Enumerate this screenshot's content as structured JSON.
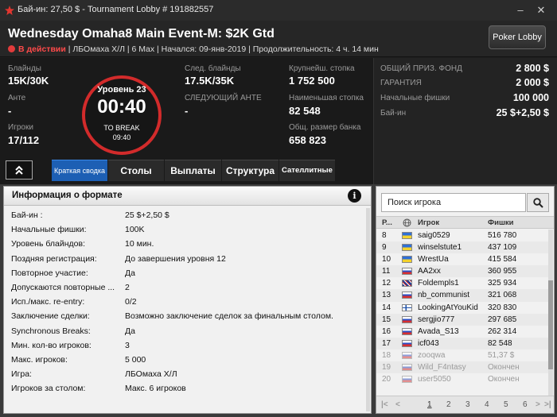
{
  "titlebar": {
    "title": "Бай-ин: 27,50 $ - Tournament Lobby # 191882557",
    "minimize": "–",
    "close": "✕"
  },
  "header": {
    "event_title": "Wednesday Omaha8 Main Event-M: $2K Gtd",
    "status": "В действии",
    "details": "| ЛБОмаха Х/Л | 6 Max | Начался: 09-янв-2019 | Продолжительность: 4 ч. 14 мин",
    "poker_lobby_label": "Poker Lobby"
  },
  "stats": {
    "blinds_label": "Блайнды",
    "blinds_value": "15K/30K",
    "ante_label": "Анте",
    "ante_value": "-",
    "players_label": "Игроки",
    "players_value": "17/112",
    "level_label": "Уровень 23",
    "clock_time": "00:40",
    "to_break_label": "TO BREAK",
    "to_break_value": "09:40",
    "next_blinds_label": "След. блайнды",
    "next_blinds_value": "17.5K/35K",
    "next_ante_label": "СЛЕДУЮЩИЙ АНТЕ",
    "next_ante_value": "-",
    "largest_stack_label": "Крупнейш. стопка",
    "largest_stack_value": "1 752 500",
    "smallest_stack_label": "Наименьшая стопка",
    "smallest_stack_value": "82 548",
    "bank_label": "Общ. размер банка",
    "bank_value": "658 823"
  },
  "prize": {
    "rows": [
      {
        "label": "ОБЩИЙ ПРИЗ. ФОНД",
        "value": "2 800 $"
      },
      {
        "label": "ГАРАНТИЯ",
        "value": "2 000 $"
      },
      {
        "label": "Начальные фишки",
        "value": "100 000"
      },
      {
        "label": "Бай-ин",
        "value": "25 $+2,50 $"
      }
    ]
  },
  "tabs": [
    {
      "label": "Краткая сводка"
    },
    {
      "label": "Столы"
    },
    {
      "label": "Выплаты"
    },
    {
      "label": "Структура"
    },
    {
      "label": "Сателлитные"
    }
  ],
  "format": {
    "title": "Информация о формате",
    "rows": [
      {
        "k": "Бай-ин :",
        "v": "25 $+2,50 $"
      },
      {
        "k": "Начальные фишки:",
        "v": "100K"
      },
      {
        "k": "Уровень блайндов:",
        "v": "10 мин."
      },
      {
        "k": "Поздняя регистрация:",
        "v": "До завершения уровня 12"
      },
      {
        "k": "Повторное участие:",
        "v": "Да"
      },
      {
        "k": "Допускаются повторные ...",
        "v": "2"
      },
      {
        "k": "Исп./макс. re-entry:",
        "v": "0/2"
      },
      {
        "k": "Заключение сделки:",
        "v": "Возможно заключение сделок за финальным столом."
      },
      {
        "k": "Synchronous Breaks:",
        "v": "Да"
      },
      {
        "k": "Мин. кол-во игроков:",
        "v": "3"
      },
      {
        "k": "Макс. игроков:",
        "v": "5 000"
      },
      {
        "k": "Игра:",
        "v": "ЛБОмаха Х/Л"
      },
      {
        "k": "Игроков за столом:",
        "v": "Макс. 6 игроков"
      }
    ]
  },
  "players": {
    "search_placeholder": "Поиск игрока",
    "col_rank": "Р...",
    "col_player": "Игрок",
    "col_chips": "Фишки",
    "rows": [
      {
        "rank": "8",
        "flag": "ua",
        "name": "saig0529",
        "chips": "516 780",
        "out": false
      },
      {
        "rank": "9",
        "flag": "ua",
        "name": "winselstute1",
        "chips": "437 109",
        "out": false
      },
      {
        "rank": "10",
        "flag": "ua",
        "name": "WrestUa",
        "chips": "415 584",
        "out": false
      },
      {
        "rank": "11",
        "flag": "ru",
        "name": "AA2xx",
        "chips": "360 955",
        "out": false
      },
      {
        "rank": "12",
        "flag": "gb",
        "name": "Foldempls1",
        "chips": "325 934",
        "out": false
      },
      {
        "rank": "13",
        "flag": "ru",
        "name": "nb_communist",
        "chips": "321 068",
        "out": false
      },
      {
        "rank": "14",
        "flag": "fi",
        "name": "LookingAtYouKid",
        "chips": "320 830",
        "out": false
      },
      {
        "rank": "15",
        "flag": "ru",
        "name": "sergjio777",
        "chips": "297 685",
        "out": false
      },
      {
        "rank": "16",
        "flag": "ru",
        "name": "Avada_S13",
        "chips": "262 314",
        "out": false
      },
      {
        "rank": "17",
        "flag": "ru",
        "name": "icf043",
        "chips": "82 548",
        "out": false
      },
      {
        "rank": "18",
        "flag": "ru",
        "name": "zooqwa",
        "chips": "51,37 $",
        "out": true
      },
      {
        "rank": "19",
        "flag": "ru",
        "name": "Wild_F4ntasy",
        "chips": "Окончен",
        "out": true
      },
      {
        "rank": "20",
        "flag": "ru",
        "name": "user5050",
        "chips": "Окончен",
        "out": true
      }
    ],
    "pages": [
      "1",
      "2",
      "3",
      "4",
      "5",
      "6"
    ]
  },
  "colors": {
    "accent_red": "#d22b2b",
    "active_tab": "#1d5fb4"
  }
}
